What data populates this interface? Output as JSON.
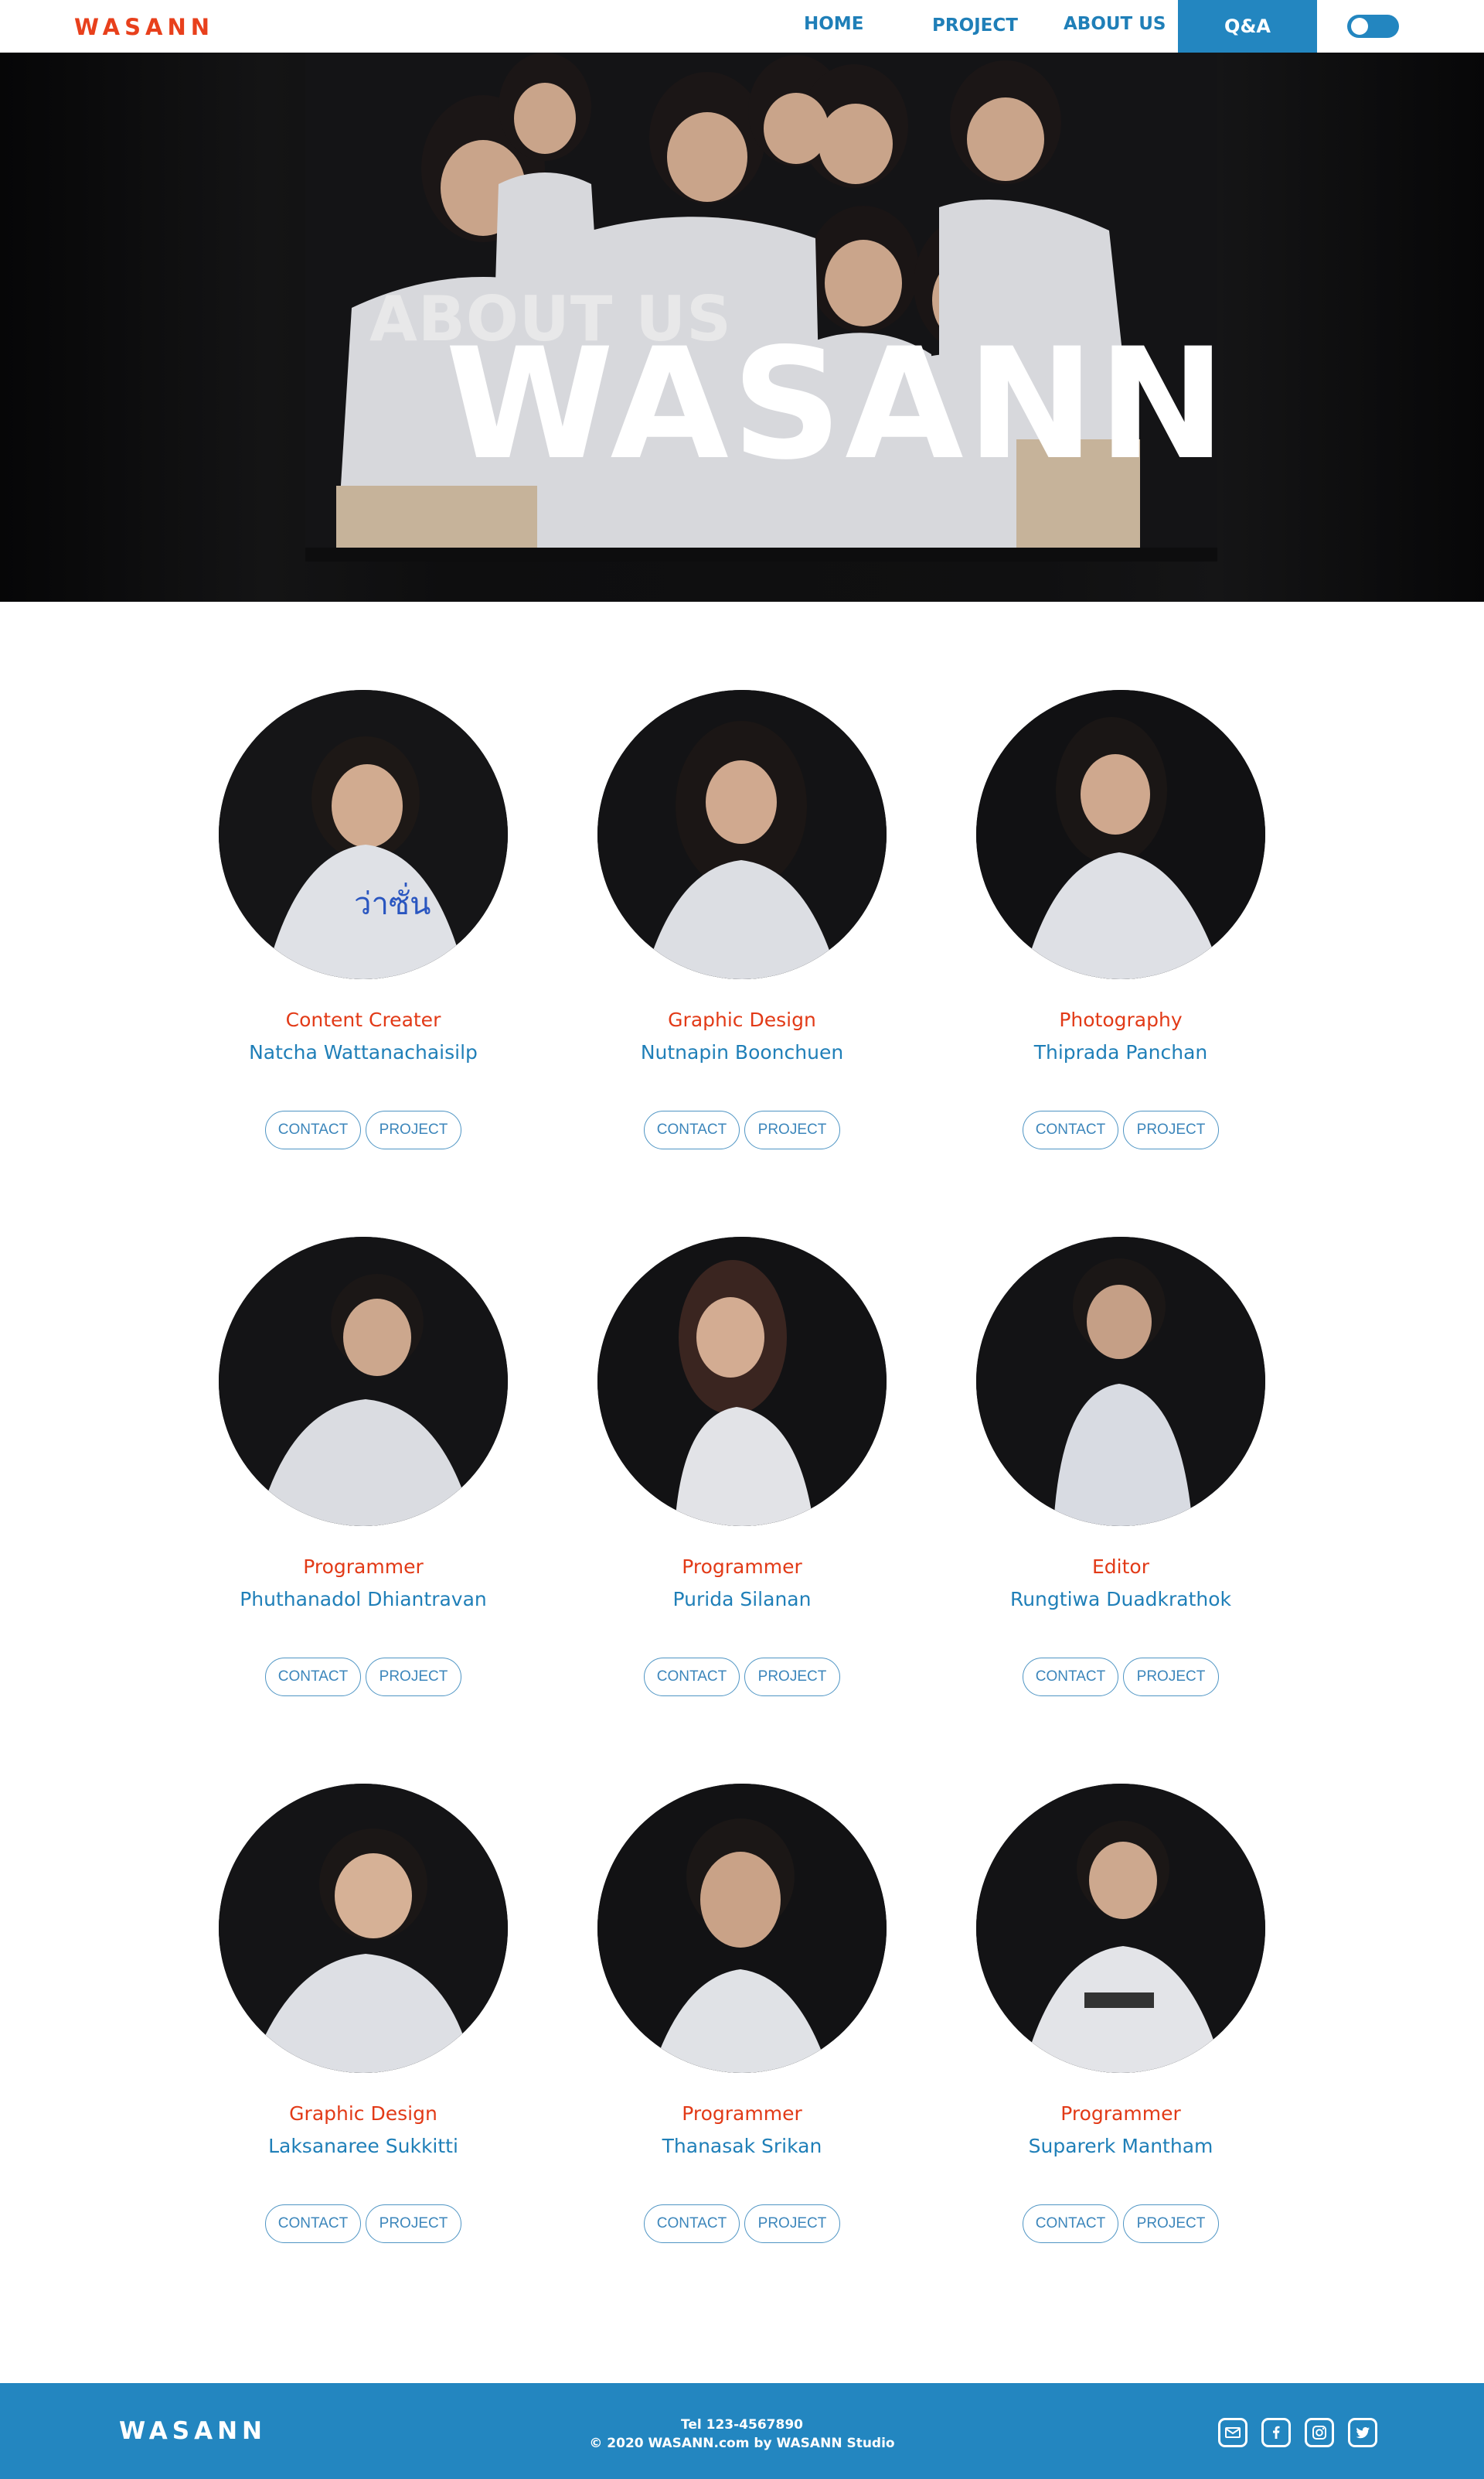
{
  "nav": {
    "brand": "WASANN",
    "links": [
      "HOME",
      "PROJECT",
      "ABOUT US",
      "Q&A"
    ],
    "toggle_state": "off"
  },
  "hero": {
    "subtitle": "ABOUT US",
    "title": "WASANN"
  },
  "team": [
    {
      "role": "Content Creater",
      "name": "Natcha Wattanachaisilp",
      "contact_label": "CONTACT",
      "project_label": "PROJECT"
    },
    {
      "role": "Graphic Design",
      "name": "Nutnapin Boonchuen",
      "contact_label": "CONTACT",
      "project_label": "PROJECT"
    },
    {
      "role": "Photography",
      "name": "Thiprada Panchan",
      "contact_label": "CONTACT",
      "project_label": "PROJECT"
    },
    {
      "role": "Programmer",
      "name": "Phuthanadol Dhiantravan",
      "contact_label": "CONTACT",
      "project_label": "PROJECT"
    },
    {
      "role": "Programmer",
      "name": "Purida Silanan",
      "contact_label": "CONTACT",
      "project_label": "PROJECT"
    },
    {
      "role": "Editor",
      "name": "Rungtiwa Duadkrathok",
      "contact_label": "CONTACT",
      "project_label": "PROJECT"
    },
    {
      "role": "Graphic Design",
      "name": "Laksanaree Sukkitti",
      "contact_label": "CONTACT",
      "project_label": "PROJECT"
    },
    {
      "role": "Programmer",
      "name": "Thanasak Srikan",
      "contact_label": "CONTACT",
      "project_label": "PROJECT"
    },
    {
      "role": "Programmer",
      "name": "Suparerk Mantham",
      "contact_label": "CONTACT",
      "project_label": "PROJECT"
    }
  ],
  "footer": {
    "brand": "WASANN",
    "tel": "Tel 123-4567890",
    "copyright": "© 2020 WASANN.com by WASANN Studio",
    "social_icons": [
      "mail-icon",
      "facebook-icon",
      "instagram-icon",
      "twitter-icon"
    ]
  },
  "colors": {
    "brand_orange": "#e8401c",
    "accent_blue": "#2386c0",
    "link_blue": "#1f7fb8",
    "role_red": "#e23a17"
  }
}
